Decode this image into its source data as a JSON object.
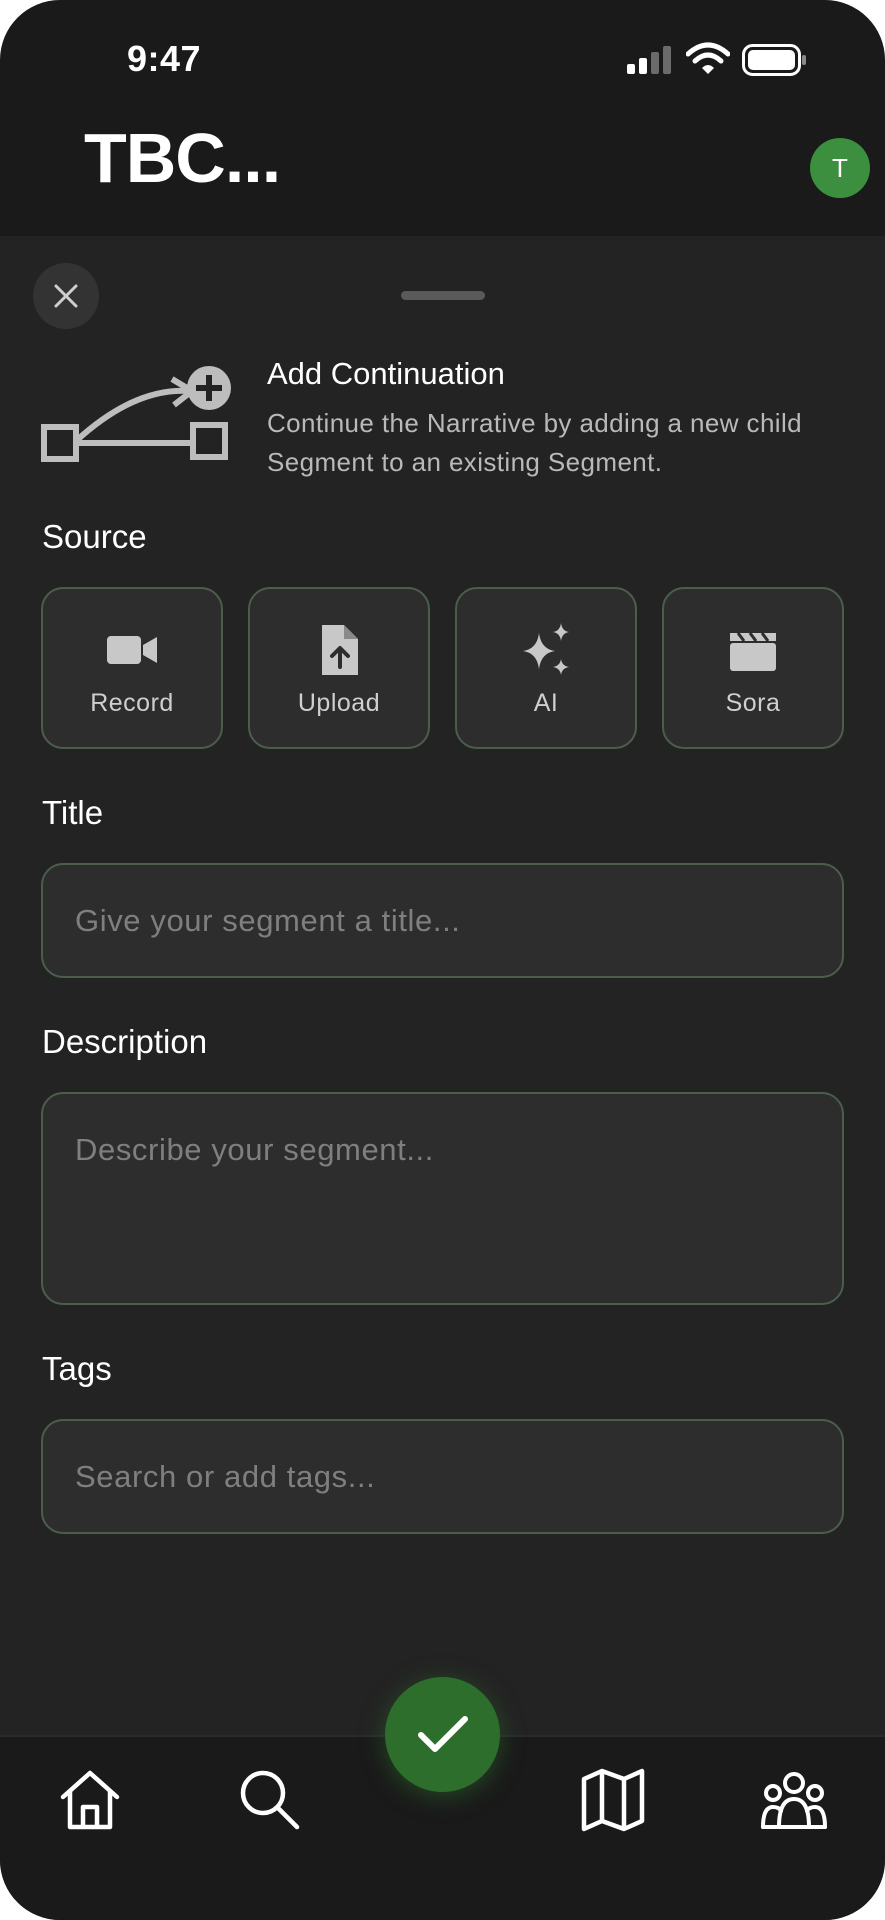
{
  "status_bar": {
    "time": "9:47"
  },
  "header": {
    "title": "TBC...",
    "avatar_initial": "T"
  },
  "sheet": {
    "intro": {
      "title": "Add Continuation",
      "description": "Continue the Narrative by adding a new child Segment to an existing Segment.",
      "icon": "branch-add-icon"
    },
    "source": {
      "label": "Source",
      "options": [
        {
          "label": "Record",
          "icon": "video-camera-icon"
        },
        {
          "label": "Upload",
          "icon": "file-upload-icon"
        },
        {
          "label": "AI",
          "icon": "sparkles-icon"
        },
        {
          "label": "Sora",
          "icon": "clapperboard-icon"
        }
      ]
    },
    "title_field": {
      "label": "Title",
      "placeholder": "Give your segment a title...",
      "value": ""
    },
    "description_field": {
      "label": "Description",
      "placeholder": "Describe your segment...",
      "value": ""
    },
    "tags_field": {
      "label": "Tags",
      "placeholder": "Search or add tags...",
      "value": ""
    }
  },
  "bottom_nav": {
    "items": [
      {
        "name": "home",
        "icon": "home-icon"
      },
      {
        "name": "search",
        "icon": "search-icon"
      },
      {
        "name": "map",
        "icon": "map-icon"
      },
      {
        "name": "community",
        "icon": "users-icon"
      }
    ],
    "fab_icon": "checkmark-icon"
  },
  "colors": {
    "background": "#1a1a1a",
    "sheet": "#232323",
    "field": "#2d2d2d",
    "field_border": "#4b5e4b",
    "accent": "#2e6e2c",
    "avatar": "#3b8f3e"
  }
}
